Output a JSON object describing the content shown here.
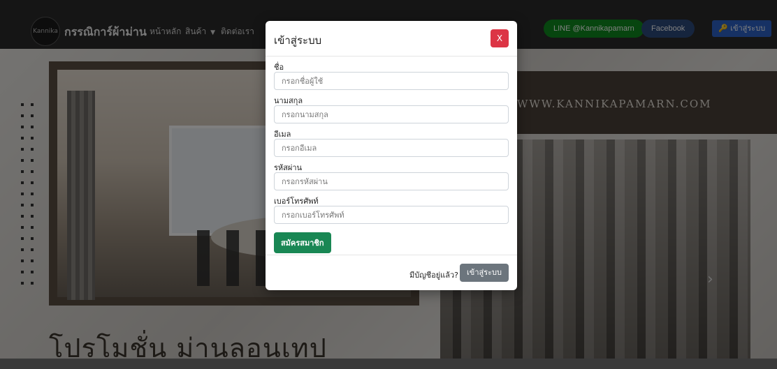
{
  "navbar": {
    "logo_text": "Kannika",
    "brand": "กรรณิการ์ผ้าม่าน",
    "links": [
      {
        "label": "หน้าหลัก"
      },
      {
        "label": "สินค้า",
        "dropdown": true
      },
      {
        "label": "ติดต่อเรา"
      }
    ],
    "line_label": "LINE @Kannikapamarn",
    "facebook_label": "Facebook",
    "login_label": "เข้าสู่ระบบ",
    "login_icon": "key-icon"
  },
  "hero": {
    "banner_text": "WWW.KANNIKAPAMARN.COM",
    "promo_text": "โปรโมชั่น ม่านลอนเทป"
  },
  "modal": {
    "title": "เข้าสู่ระบบ",
    "close_label": "X",
    "fields": [
      {
        "label": "ชื่อ",
        "placeholder": "กรอกชื่อผู้ใช้"
      },
      {
        "label": "นามสกุล",
        "placeholder": "กรอกนามสกุล"
      },
      {
        "label": "อีเมล",
        "placeholder": "กรอกอีเมล"
      },
      {
        "label": "รหัสผ่าน",
        "placeholder": "กรอกรหัสผ่าน"
      },
      {
        "label": "เบอร์โทรศัพท์",
        "placeholder": "กรอกเบอร์โทรศัพท์"
      }
    ],
    "register_label": "สมัครสมาชิก",
    "footer_question": "มีบัญชีอยู่แล้ว?",
    "footer_login_label": "เข้าสู่ระบบ"
  },
  "colors": {
    "close": "#dc3545",
    "register": "#198754",
    "line": "#0f8b1e",
    "facebook": "#2c4a7d",
    "login_top": "#2d63c8",
    "footer_btn": "#6c757d"
  }
}
